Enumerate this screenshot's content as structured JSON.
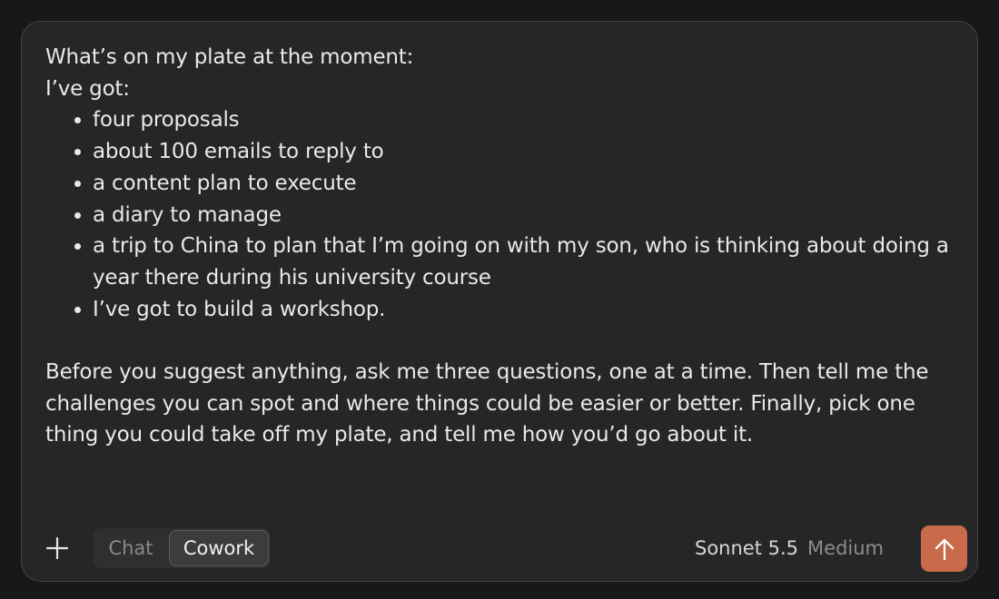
{
  "message": {
    "intro_line1": "What’s on my plate at the moment:",
    "intro_line2": "I’ve got:",
    "items": [
      "four proposals",
      "about 100 emails to reply to",
      "a content plan to execute",
      "a diary to manage",
      "a trip to China to plan that I’m going on with my son, who is thinking about doing a year there during his university course",
      "I’ve got to build a workshop."
    ],
    "closing": "Before you suggest anything, ask me three questions, one at a time. Then tell me the challenges you can spot and where things could be easier or better. Finally, pick one thing you could take off my plate, and tell me how you’d go about it."
  },
  "toolbar": {
    "add_icon": "plus-icon",
    "modes": {
      "chat_label": "Chat",
      "cowork_label": "Cowork",
      "selected": "Cowork"
    },
    "model": {
      "name": "Sonnet 5.5",
      "effort": "Medium"
    },
    "send_icon": "arrow-up-icon"
  },
  "colors": {
    "background": "#181818",
    "composer_bg": "#262626",
    "send_button": "#c96a4a"
  }
}
